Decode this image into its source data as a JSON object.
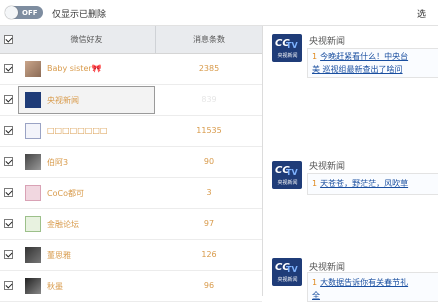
{
  "toolbar": {
    "toggle_label": "OFF",
    "only_deleted_label": "仅显示已删除",
    "right_text": "选"
  },
  "table": {
    "headers": {
      "friend": "微信好友",
      "count": "消息条数"
    },
    "rows": [
      {
        "name": "Baby sister🎀",
        "count": "2385",
        "checked": true,
        "avatar": "photo-avatar"
      },
      {
        "name": "央视新闻",
        "count": "839",
        "checked": true,
        "avatar": "cctv-avatar",
        "selected": true
      },
      {
        "name": "□□□□□□□□",
        "count": "11535",
        "checked": true,
        "avatar": "group-avatar"
      },
      {
        "name": "伯阿3",
        "count": "90",
        "checked": true,
        "avatar": "photo-avatar"
      },
      {
        "name": "CoCo都可",
        "count": "3",
        "checked": true,
        "avatar": "logo-avatar"
      },
      {
        "name": "金融论坛",
        "count": "97",
        "checked": true,
        "avatar": "logo-avatar"
      },
      {
        "name": "董思雅",
        "count": "126",
        "checked": true,
        "avatar": "photo-avatar"
      },
      {
        "name": "秋墨",
        "count": "96",
        "checked": true,
        "avatar": "photo-avatar"
      }
    ]
  },
  "messages": [
    {
      "sender": "央视新闻",
      "logo_text": "央视新闻",
      "lines": [
        {
          "num": "1",
          "text": "今晚赶紧看什么！中央台"
        },
        {
          "num": "",
          "text": "美 巡视组最新查出了啥问"
        }
      ]
    },
    {
      "sender": "央视新闻",
      "logo_text": "央视新闻",
      "lines": [
        {
          "num": "1",
          "text": "天苍苍，野茫茫，风吹草"
        }
      ]
    },
    {
      "sender": "央视新闻",
      "logo_text": "央视新闻",
      "lines": [
        {
          "num": "1",
          "text": "大数据告诉你有关春节礼"
        },
        {
          "num": "",
          "text": "全"
        }
      ]
    }
  ],
  "colors": {
    "accent": "#d89a4a",
    "link": "#1a4fa0",
    "cctv": "#1f3c78"
  }
}
